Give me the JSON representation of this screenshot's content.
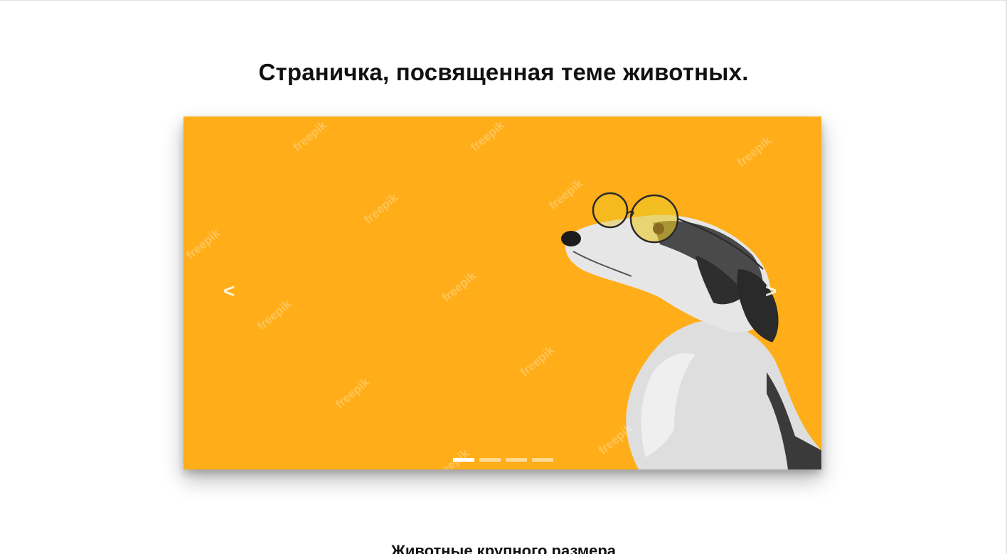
{
  "header": {
    "title": "Страничка, посвященная теме животных."
  },
  "slider": {
    "background_color": "#FFAE19",
    "image_icon": "dog-with-glasses-image",
    "watermark_text": "freepik",
    "prev_label": "<",
    "next_label": ">",
    "slide_count": 4,
    "active_slide": 1
  },
  "sections": [
    {
      "title": "Животные крупного размера"
    }
  ]
}
